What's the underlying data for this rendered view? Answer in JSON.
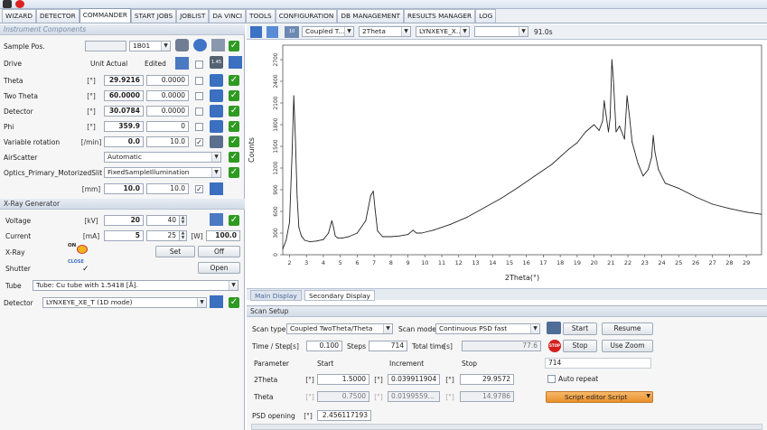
{
  "menu": {
    "tabs": [
      "WIZARD",
      "DETECTOR",
      "COMMANDER",
      "START JOBS",
      "JOBLIST",
      "DA VINCI",
      "TOOLS",
      "CONFIGURATION",
      "DB MANAGEMENT",
      "RESULTS MANAGER",
      "LOG"
    ],
    "active": "COMMANDER"
  },
  "instrument": {
    "section_title": "Instrument Components",
    "sample_pos_label": "Sample Pos.",
    "sample_pos_value": "1B01",
    "drive_label": "Drive",
    "unit_actual_label": "Unit Actual",
    "edited_label": "Edited",
    "rows": [
      {
        "name": "Theta",
        "unit": "[°]",
        "actual": "29.9216",
        "edited": "0.0000"
      },
      {
        "name": "Two Theta",
        "unit": "[°]",
        "actual": "60.0000",
        "edited": "0.0000"
      },
      {
        "name": "Detector",
        "unit": "[°]",
        "actual": "30.0784",
        "edited": "0.0000"
      },
      {
        "name": "Phi",
        "unit": "[°]",
        "actual": "359.9",
        "edited": "0"
      },
      {
        "name": "Variable rotation",
        "unit": "[/min]",
        "actual": "0.0",
        "edited": "10.0"
      }
    ],
    "airscatter_label": "AirScatter",
    "airscatter_value": "Automatic",
    "optics_label": "Optics_Primary_MotorizedSlit",
    "optics_value": "FixedSampleIllumination",
    "optics_unit": "[mm]",
    "optics_actual": "10.0",
    "optics_edited": "10.0"
  },
  "xray": {
    "section_title": "X-Ray Generator",
    "voltage_label": "Voltage",
    "voltage_unit": "[kV]",
    "voltage_actual": "20",
    "voltage_edited": "40",
    "current_label": "Current",
    "current_unit": "[mA]",
    "current_actual": "5",
    "current_edited": "25",
    "power_unit": "[W]",
    "power_value": "100.0",
    "xray_label": "X-Ray",
    "on_badge": "ON",
    "set_label": "Set",
    "off_label": "Off",
    "shutter_label": "Shutter",
    "close_badge": "CLOSE",
    "open_label": "Open",
    "tube_label": "Tube",
    "tube_value": "Tube: Cu tube with 1.5418 [Å].",
    "detector_label": "Detector",
    "detector_value": "LYNXEYE_XE_T (1D mode)"
  },
  "chart_toolbar": {
    "scan_select": "Coupled T...",
    "axis_select": "2Theta",
    "detector_select": "LYNXEYE_X...",
    "empty_select": "",
    "time_readout": "91.0s"
  },
  "bottom_tabs": {
    "main": "Main Display",
    "secondary": "Secondary Display"
  },
  "scan_setup": {
    "title": "Scan Setup",
    "scan_type_label": "Scan type",
    "scan_type_value": "Coupled TwoTheta/Theta",
    "scan_mode_label": "Scan mode",
    "scan_mode_value": "Continuous PSD fast",
    "time_step_label": "Time / Step",
    "time_step_unit": "[s]",
    "time_step_value": "0.100",
    "steps_label": "Steps",
    "steps_value": "714",
    "total_time_label": "Total time",
    "total_time_unit": "[s]",
    "total_time_value": "77.6",
    "param_label": "Parameter",
    "start_label": "Start",
    "increment_label": "Increment",
    "stop_label": "Stop",
    "twotheta_label": "2Theta",
    "twotheta_unit": "[°]",
    "twotheta_start": "1.5000",
    "twotheta_inc": "0.039911904",
    "twotheta_stop": "29.9572",
    "theta_label": "Theta",
    "theta_unit": "[°]",
    "theta_start": "0.7500",
    "theta_inc": "0.0199559...",
    "theta_stop": "14.9786",
    "psd_label": "PSD opening",
    "psd_unit": "[°]",
    "psd_value": "2.456117193",
    "start_btn": "Start",
    "resume_btn": "Resume",
    "stop_btn": "Stop",
    "usezoom_btn": "Use Zoom",
    "steps_readout": "714",
    "auto_repeat_label": "Auto repeat",
    "script_btn": "Script editor Script"
  },
  "chart_data": {
    "type": "line",
    "xlabel": "2Theta(°)",
    "ylabel": "Counts",
    "xlim": [
      1.6,
      29.9
    ],
    "ylim": [
      0,
      2900
    ],
    "xticks": [
      2,
      3,
      4,
      5,
      6,
      7,
      8,
      9,
      10,
      11,
      12,
      13,
      14,
      15,
      16,
      17,
      18,
      19,
      20,
      21,
      22,
      23,
      24,
      25,
      26,
      27,
      28,
      29
    ],
    "yticks": [
      0,
      300,
      600,
      900,
      1200,
      1500,
      1800,
      2100,
      2400,
      2700
    ],
    "series": [
      {
        "color": "#222222",
        "x": [
          1.6,
          1.8,
          2.0,
          2.15,
          2.25,
          2.35,
          2.45,
          2.55,
          2.7,
          2.9,
          3.2,
          3.6,
          4.0,
          4.3,
          4.5,
          4.6,
          4.7,
          4.85,
          5.1,
          5.5,
          6.0,
          6.5,
          6.8,
          6.95,
          7.05,
          7.2,
          7.5,
          8.0,
          8.5,
          9.0,
          9.3,
          9.5,
          9.8,
          10.5,
          11.5,
          12.5,
          13.5,
          14.5,
          15.5,
          16.5,
          17.5,
          18.5,
          19.0,
          19.5,
          20.0,
          20.3,
          20.5,
          20.6,
          20.7,
          20.85,
          20.95,
          21.05,
          21.15,
          21.3,
          21.5,
          21.8,
          21.95,
          22.1,
          22.25,
          22.4,
          22.6,
          22.9,
          23.2,
          23.4,
          23.5,
          23.6,
          23.8,
          24.2,
          25.0,
          26.0,
          27.0,
          28.0,
          29.0,
          29.9
        ],
        "y": [
          80,
          200,
          450,
          1400,
          2200,
          1600,
          800,
          380,
          260,
          200,
          180,
          190,
          210,
          300,
          470,
          380,
          260,
          230,
          230,
          250,
          300,
          470,
          820,
          880,
          640,
          330,
          250,
          250,
          260,
          280,
          340,
          300,
          300,
          340,
          420,
          520,
          650,
          780,
          930,
          1090,
          1250,
          1460,
          1550,
          1700,
          1800,
          1720,
          1850,
          2130,
          1950,
          1700,
          1900,
          2700,
          2400,
          1700,
          1780,
          1600,
          2200,
          1900,
          1560,
          1430,
          1260,
          1090,
          1180,
          1350,
          1650,
          1420,
          1180,
          990,
          920,
          800,
          700,
          640,
          590,
          560
        ]
      }
    ]
  }
}
